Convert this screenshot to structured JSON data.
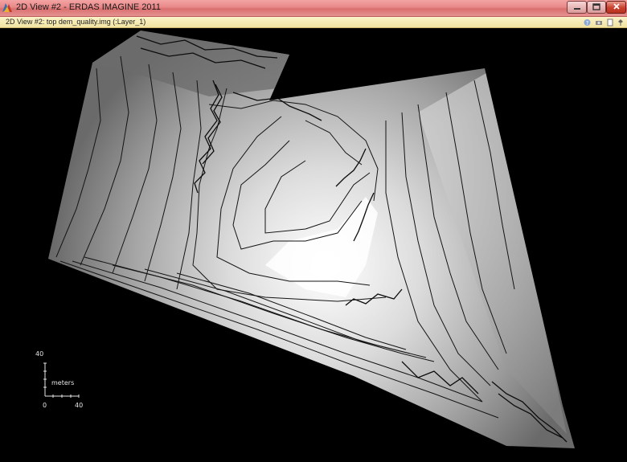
{
  "window": {
    "title": "2D View #2 - ERDAS IMAGINE 2011",
    "app_icon": "erdas-logo-icon",
    "controls": {
      "minimize": "minimize-icon",
      "maximize": "maximize-icon",
      "close": "close-icon"
    }
  },
  "viewer": {
    "tab_label": "2D View #2: top dem_quality.img (:Layer_1)",
    "tab_icons": [
      "help-icon",
      "camera-icon",
      "document-icon",
      "pin-icon"
    ]
  },
  "scalebar": {
    "vertical_value": "40",
    "unit": "meters",
    "origin_value": "0",
    "horizontal_value": "40"
  },
  "colors": {
    "titlebar": "#e88888",
    "tabstrip": "#f6eab4",
    "canvas_background": "#000000",
    "contour_lines": "#141414"
  }
}
